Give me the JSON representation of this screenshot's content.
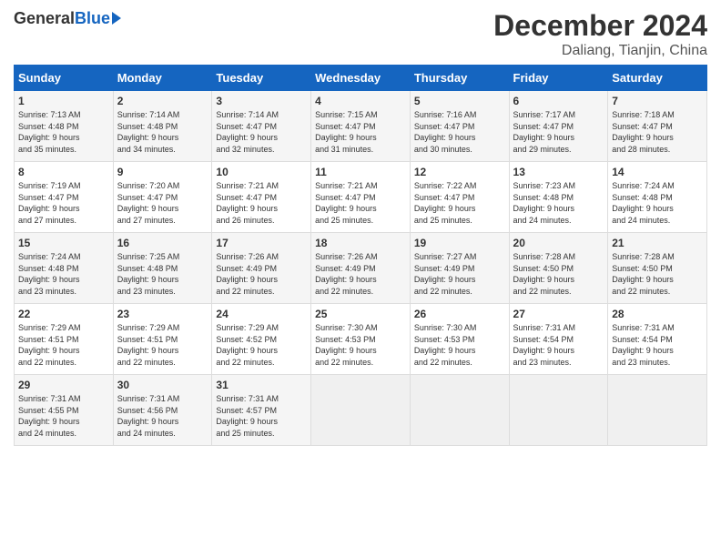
{
  "header": {
    "logo_general": "General",
    "logo_blue": "Blue",
    "month_title": "December 2024",
    "location": "Daliang, Tianjin, China"
  },
  "days_of_week": [
    "Sunday",
    "Monday",
    "Tuesday",
    "Wednesday",
    "Thursday",
    "Friday",
    "Saturday"
  ],
  "weeks": [
    [
      {
        "day": "1",
        "info": "Sunrise: 7:13 AM\nSunset: 4:48 PM\nDaylight: 9 hours\nand 35 minutes."
      },
      {
        "day": "2",
        "info": "Sunrise: 7:14 AM\nSunset: 4:48 PM\nDaylight: 9 hours\nand 34 minutes."
      },
      {
        "day": "3",
        "info": "Sunrise: 7:14 AM\nSunset: 4:47 PM\nDaylight: 9 hours\nand 32 minutes."
      },
      {
        "day": "4",
        "info": "Sunrise: 7:15 AM\nSunset: 4:47 PM\nDaylight: 9 hours\nand 31 minutes."
      },
      {
        "day": "5",
        "info": "Sunrise: 7:16 AM\nSunset: 4:47 PM\nDaylight: 9 hours\nand 30 minutes."
      },
      {
        "day": "6",
        "info": "Sunrise: 7:17 AM\nSunset: 4:47 PM\nDaylight: 9 hours\nand 29 minutes."
      },
      {
        "day": "7",
        "info": "Sunrise: 7:18 AM\nSunset: 4:47 PM\nDaylight: 9 hours\nand 28 minutes."
      }
    ],
    [
      {
        "day": "8",
        "info": "Sunrise: 7:19 AM\nSunset: 4:47 PM\nDaylight: 9 hours\nand 27 minutes."
      },
      {
        "day": "9",
        "info": "Sunrise: 7:20 AM\nSunset: 4:47 PM\nDaylight: 9 hours\nand 27 minutes."
      },
      {
        "day": "10",
        "info": "Sunrise: 7:21 AM\nSunset: 4:47 PM\nDaylight: 9 hours\nand 26 minutes."
      },
      {
        "day": "11",
        "info": "Sunrise: 7:21 AM\nSunset: 4:47 PM\nDaylight: 9 hours\nand 25 minutes."
      },
      {
        "day": "12",
        "info": "Sunrise: 7:22 AM\nSunset: 4:47 PM\nDaylight: 9 hours\nand 25 minutes."
      },
      {
        "day": "13",
        "info": "Sunrise: 7:23 AM\nSunset: 4:48 PM\nDaylight: 9 hours\nand 24 minutes."
      },
      {
        "day": "14",
        "info": "Sunrise: 7:24 AM\nSunset: 4:48 PM\nDaylight: 9 hours\nand 24 minutes."
      }
    ],
    [
      {
        "day": "15",
        "info": "Sunrise: 7:24 AM\nSunset: 4:48 PM\nDaylight: 9 hours\nand 23 minutes."
      },
      {
        "day": "16",
        "info": "Sunrise: 7:25 AM\nSunset: 4:48 PM\nDaylight: 9 hours\nand 23 minutes."
      },
      {
        "day": "17",
        "info": "Sunrise: 7:26 AM\nSunset: 4:49 PM\nDaylight: 9 hours\nand 22 minutes."
      },
      {
        "day": "18",
        "info": "Sunrise: 7:26 AM\nSunset: 4:49 PM\nDaylight: 9 hours\nand 22 minutes."
      },
      {
        "day": "19",
        "info": "Sunrise: 7:27 AM\nSunset: 4:49 PM\nDaylight: 9 hours\nand 22 minutes."
      },
      {
        "day": "20",
        "info": "Sunrise: 7:28 AM\nSunset: 4:50 PM\nDaylight: 9 hours\nand 22 minutes."
      },
      {
        "day": "21",
        "info": "Sunrise: 7:28 AM\nSunset: 4:50 PM\nDaylight: 9 hours\nand 22 minutes."
      }
    ],
    [
      {
        "day": "22",
        "info": "Sunrise: 7:29 AM\nSunset: 4:51 PM\nDaylight: 9 hours\nand 22 minutes."
      },
      {
        "day": "23",
        "info": "Sunrise: 7:29 AM\nSunset: 4:51 PM\nDaylight: 9 hours\nand 22 minutes."
      },
      {
        "day": "24",
        "info": "Sunrise: 7:29 AM\nSunset: 4:52 PM\nDaylight: 9 hours\nand 22 minutes."
      },
      {
        "day": "25",
        "info": "Sunrise: 7:30 AM\nSunset: 4:53 PM\nDaylight: 9 hours\nand 22 minutes."
      },
      {
        "day": "26",
        "info": "Sunrise: 7:30 AM\nSunset: 4:53 PM\nDaylight: 9 hours\nand 22 minutes."
      },
      {
        "day": "27",
        "info": "Sunrise: 7:31 AM\nSunset: 4:54 PM\nDaylight: 9 hours\nand 23 minutes."
      },
      {
        "day": "28",
        "info": "Sunrise: 7:31 AM\nSunset: 4:54 PM\nDaylight: 9 hours\nand 23 minutes."
      }
    ],
    [
      {
        "day": "29",
        "info": "Sunrise: 7:31 AM\nSunset: 4:55 PM\nDaylight: 9 hours\nand 24 minutes."
      },
      {
        "day": "30",
        "info": "Sunrise: 7:31 AM\nSunset: 4:56 PM\nDaylight: 9 hours\nand 24 minutes."
      },
      {
        "day": "31",
        "info": "Sunrise: 7:31 AM\nSunset: 4:57 PM\nDaylight: 9 hours\nand 25 minutes."
      },
      {
        "day": "",
        "info": ""
      },
      {
        "day": "",
        "info": ""
      },
      {
        "day": "",
        "info": ""
      },
      {
        "day": "",
        "info": ""
      }
    ]
  ]
}
